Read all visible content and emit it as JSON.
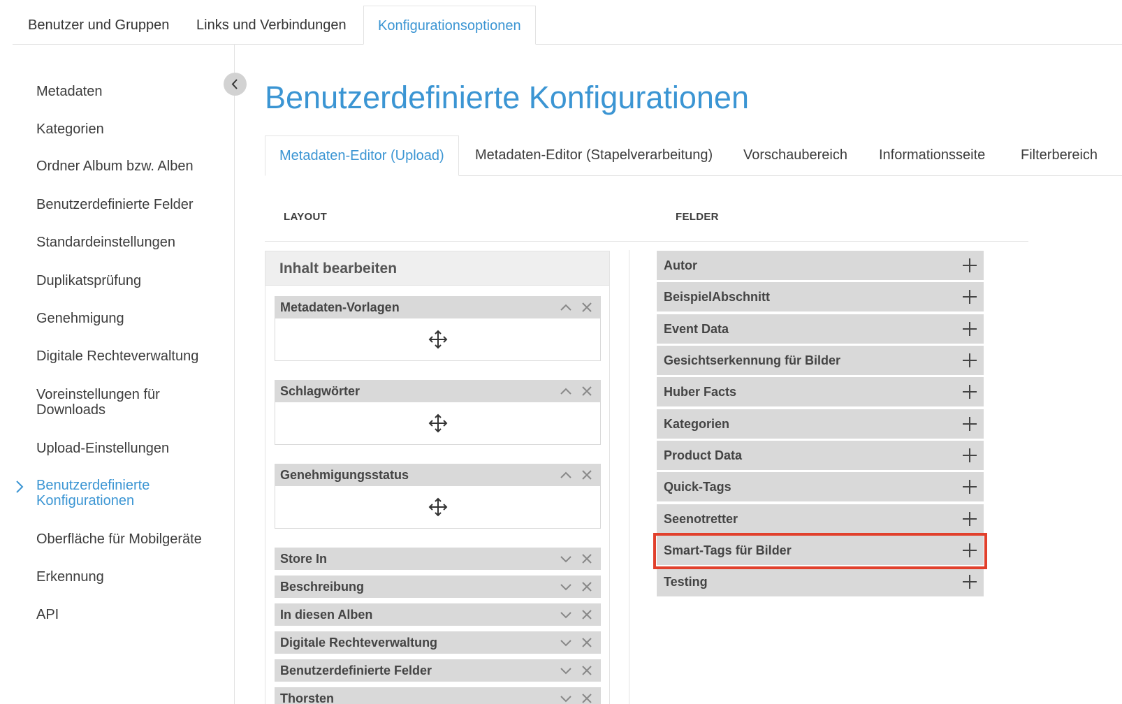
{
  "top_tabs": [
    {
      "label": "Benutzer und Gruppen"
    },
    {
      "label": "Links und Verbindungen"
    },
    {
      "label": "Konfigurationsoptionen",
      "active": true
    }
  ],
  "sidebar": {
    "items": [
      {
        "label": "Metadaten"
      },
      {
        "label": "Kategorien"
      },
      {
        "label": "Ordner Album bzw. Alben"
      },
      {
        "label": "Benutzerdefinierte Felder"
      },
      {
        "label": "Standardeinstellungen"
      },
      {
        "label": "Duplikatsprüfung"
      },
      {
        "label": "Genehmigung"
      },
      {
        "label": "Digitale Rechteverwaltung"
      },
      {
        "label": "Voreinstellungen für Downloads"
      },
      {
        "label": "Upload-Einstellungen"
      },
      {
        "label": "Benutzerdefinierte Konfigurationen",
        "active": true
      },
      {
        "label": "Oberfläche für Mobilgeräte"
      },
      {
        "label": "Erkennung"
      },
      {
        "label": "API"
      }
    ]
  },
  "main": {
    "title": "Benutzerdefinierte Konfigurationen",
    "tabs": [
      {
        "label": "Metadaten-Editor (Upload)",
        "active": true
      },
      {
        "label": "Metadaten-Editor (Stapelverarbeitung)"
      },
      {
        "label": "Vorschaubereich"
      },
      {
        "label": "Informationsseite"
      },
      {
        "label": "Filterbereich"
      }
    ],
    "layout_heading": "LAYOUT",
    "fields_heading": "FELDER"
  },
  "layout": {
    "panel_title": "Inhalt bearbeiten",
    "expanded_blocks": [
      {
        "label": "Metadaten-Vorlagen"
      },
      {
        "label": "Schlagwörter"
      },
      {
        "label": "Genehmigungsstatus"
      }
    ],
    "collapsed_rows": [
      {
        "label": "Store In"
      },
      {
        "label": "Beschreibung"
      },
      {
        "label": "In diesen Alben"
      },
      {
        "label": "Digitale Rechteverwaltung"
      },
      {
        "label": "Benutzerdefinierte Felder"
      },
      {
        "label": "Thorsten"
      }
    ]
  },
  "fields": [
    {
      "label": "Autor"
    },
    {
      "label": "BeispielAbschnitt"
    },
    {
      "label": "Event Data"
    },
    {
      "label": "Gesichtserkennung für Bilder"
    },
    {
      "label": "Huber Facts"
    },
    {
      "label": "Kategorien"
    },
    {
      "label": "Product Data"
    },
    {
      "label": "Quick-Tags"
    },
    {
      "label": "Seenotretter"
    },
    {
      "label": "Smart-Tags für Bilder",
      "highlighted": true
    },
    {
      "label": "Testing"
    }
  ],
  "colors": {
    "accent": "#3b95d3",
    "highlight": "#e1402c",
    "bar": "#d9d9d9"
  }
}
